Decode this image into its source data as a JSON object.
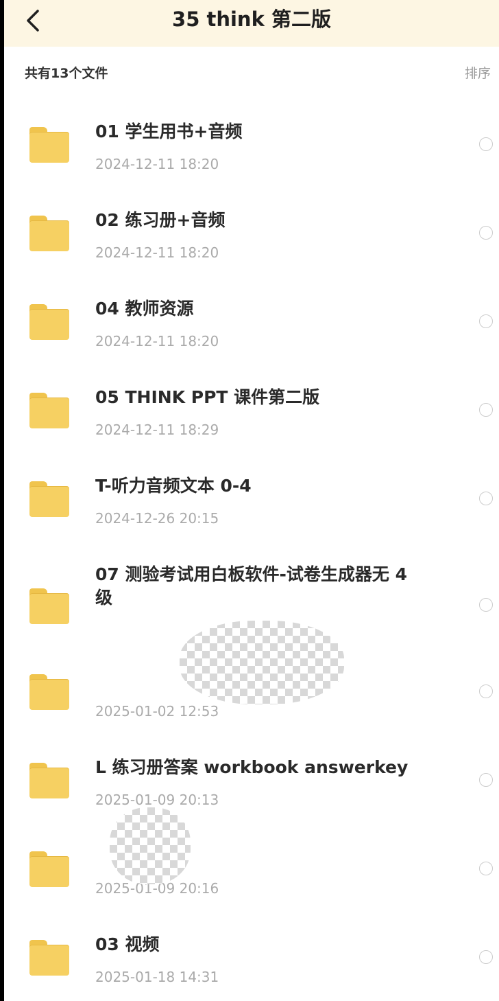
{
  "header": {
    "title": "35 think 第二版",
    "back_icon": "chevron-left-icon"
  },
  "subbar": {
    "count_label": "共有13个文件",
    "sort_label": "排序"
  },
  "files": [
    {
      "name": "01 学生用书+音频",
      "date": "2024-12-11 18:20"
    },
    {
      "name": "02 练习册+音频",
      "date": "2024-12-11 18:20"
    },
    {
      "name": "04 教师资源",
      "date": "2024-12-11 18:20"
    },
    {
      "name": "05 THINK PPT 课件第二版",
      "date": "2024-12-11 18:29"
    },
    {
      "name": "T-听力音频文本 0-4",
      "date": "2024-12-26 20:15"
    },
    {
      "name": "07 测验考试用白板软件-试卷生成器无 4 级",
      "date": ""
    },
    {
      "name": "",
      "date": "2025-01-02 12:53"
    },
    {
      "name": "L 练习册答案 workbook answerkey",
      "date": "2025-01-09 20:13"
    },
    {
      "name": "",
      "date": "2025-01-09 20:16"
    },
    {
      "name": "03 视频",
      "date": "2025-01-18 14:31"
    }
  ],
  "colors": {
    "header_bg": "#fdf6e3",
    "folder": "#f6d062",
    "date_text": "#aaaaaa"
  }
}
